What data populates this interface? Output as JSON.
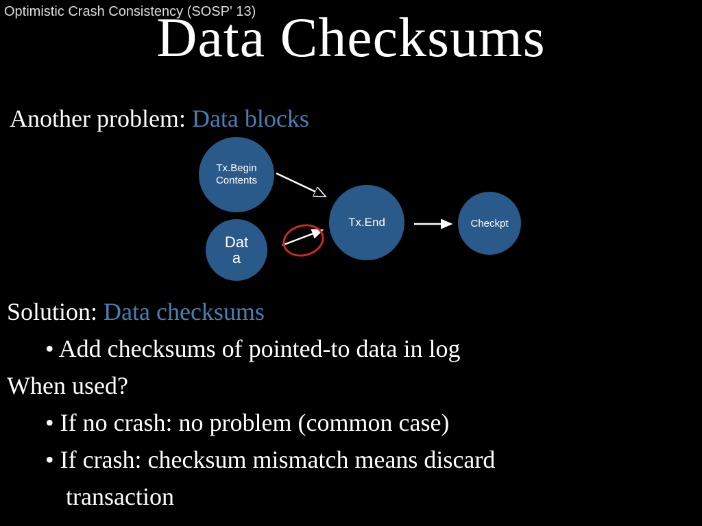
{
  "header_note": "Optimistic Crash Consistency (SOSP' 13)",
  "title": "Data Checksums",
  "problem": {
    "prefix": "Another problem: ",
    "accent": "Data blocks"
  },
  "diagram": {
    "txbegin": "Tx.Begin\nContents",
    "data": "Dat\na",
    "txend": "Tx.End",
    "checkpt": "Checkpt"
  },
  "solution": {
    "line1_prefix": "Solution: ",
    "line1_accent": "Data checksums",
    "bullet1": "Add checksums of pointed-to data in log",
    "line2": "When used?",
    "bullet2": "If no crash: no problem (common case)",
    "bullet3": "If crash: checksum mismatch means discard",
    "bullet3b": "transaction"
  }
}
